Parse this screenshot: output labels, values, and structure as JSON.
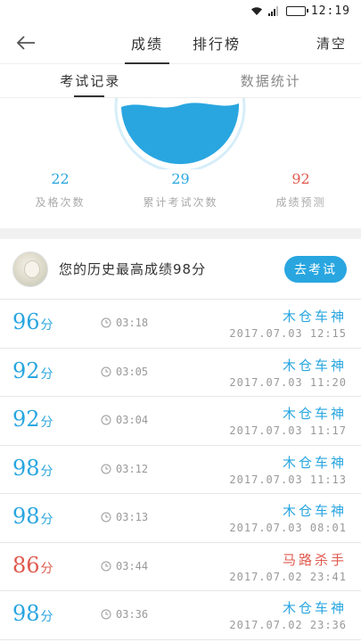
{
  "status_bar": {
    "time": "12:19"
  },
  "header": {
    "tabs": [
      "成绩",
      "排行榜"
    ],
    "clear_label": "清空"
  },
  "subtabs": [
    "考试记录",
    "数据统计"
  ],
  "stats": [
    {
      "value": "22",
      "label": "及格次数"
    },
    {
      "value": "29",
      "label": "累计考试次数"
    },
    {
      "value": "92",
      "label": "成绩预测"
    }
  ],
  "best": {
    "text": "您的历史最高成绩98分",
    "button_label": "去考试"
  },
  "records": [
    {
      "score": "96",
      "unit": "分",
      "duration": "03:18",
      "name": "木仓车神",
      "date": "2017.07.03  12:15",
      "red": false
    },
    {
      "score": "92",
      "unit": "分",
      "duration": "03:05",
      "name": "木仓车神",
      "date": "2017.07.03  11:20",
      "red": false
    },
    {
      "score": "92",
      "unit": "分",
      "duration": "03:04",
      "name": "木仓车神",
      "date": "2017.07.03  11:17",
      "red": false
    },
    {
      "score": "98",
      "unit": "分",
      "duration": "03:12",
      "name": "木仓车神",
      "date": "2017.07.03  11:13",
      "red": false
    },
    {
      "score": "98",
      "unit": "分",
      "duration": "03:13",
      "name": "木仓车神",
      "date": "2017.07.03  08:01",
      "red": false
    },
    {
      "score": "86",
      "unit": "分",
      "duration": "03:44",
      "name": "马路杀手",
      "date": "2017.07.02  23:41",
      "red": true
    },
    {
      "score": "98",
      "unit": "分",
      "duration": "03:36",
      "name": "木仓车神",
      "date": "2017.07.02  23:36",
      "red": false
    }
  ],
  "colors": {
    "accent": "#29a6e0",
    "fail": "#e05a4e",
    "battery": "#2bbd39"
  },
  "icons": [
    "wifi-icon",
    "signal-icon",
    "battery-icon",
    "back-arrow-icon",
    "clock-icon"
  ]
}
